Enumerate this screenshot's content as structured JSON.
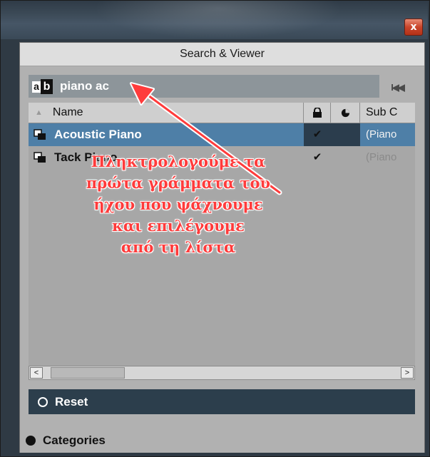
{
  "window": {
    "close_glyph": "x",
    "panel_title": "Search & Viewer"
  },
  "search": {
    "icon_a": "a",
    "icon_b": "b",
    "query": "piano ac",
    "rewind_glyph": "I◀◀"
  },
  "table": {
    "columns": {
      "sort_glyph": "▲",
      "name": "Name",
      "lock_icon": "lock-icon",
      "pie_icon": "pie-icon",
      "sub": "Sub C"
    },
    "rows": [
      {
        "name": "Acoustic Piano",
        "check": "✔",
        "sub": "(Piano",
        "selected": true
      },
      {
        "name": "Tack Piano",
        "check": "✔",
        "sub": "(Piano",
        "selected": false
      }
    ]
  },
  "scrollbar": {
    "left_glyph": "<",
    "right_glyph": ">"
  },
  "reset": {
    "label": "Reset"
  },
  "categories": {
    "label": "Categories"
  },
  "annotation": {
    "lines": [
      "Πληκτρολογούμε τα",
      "πρώτα γράμματα του",
      "ήχου που ψάχνουμε",
      "και επιλέγουμε",
      "από τη λίστα"
    ]
  },
  "colors": {
    "selection": "#4e7fa7",
    "dark_bar": "#2c3e4c",
    "annotation": "#ff3b3b"
  }
}
